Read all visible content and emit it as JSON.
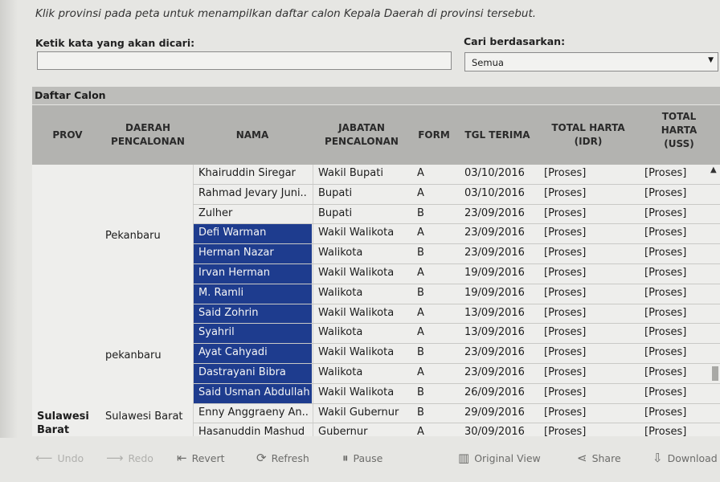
{
  "instruction": "Klik provinsi pada peta untuk menampilkan daftar calon Kepala Daerah di provinsi tersebut.",
  "search": {
    "label": "Ketik kata yang akan dicari:",
    "value": ""
  },
  "filter": {
    "label": "Cari berdasarkan:",
    "value": "Semua"
  },
  "table": {
    "title": "Daftar Calon",
    "headers": {
      "prov": "PROV",
      "daerah_1": "DAERAH",
      "daerah_2": "PENCALONAN",
      "nama": "NAMA",
      "jabatan_1": "JABATAN",
      "jabatan_2": "PENCALONAN",
      "form": "FORM",
      "tgl": "TGL TERIMA",
      "harta_idr_1": "TOTAL HARTA",
      "harta_idr_2": "(IDR)",
      "harta_uss_1": "TOTAL",
      "harta_uss_2": "HARTA",
      "harta_uss_3": "(USS)"
    },
    "groups": [
      {
        "prov": "",
        "daerah": "Pekanbaru"
      },
      {
        "prov": "",
        "daerah": "pekanbaru"
      },
      {
        "prov_1": "Sulawesi",
        "prov_2": "Barat",
        "daerah": "Sulawesi Barat"
      }
    ],
    "rows": [
      {
        "nama": "Khairuddin Siregar",
        "jabatan": "Wakil Bupati",
        "form": "A",
        "tgl": "03/10/2016",
        "idr": "[Proses]",
        "uss": "[Proses]",
        "selected": false
      },
      {
        "nama": "Rahmad Jevary Juni..",
        "jabatan": "Bupati",
        "form": "A",
        "tgl": "03/10/2016",
        "idr": "[Proses]",
        "uss": "[Proses]",
        "selected": false
      },
      {
        "nama": "Zulher",
        "jabatan": "Bupati",
        "form": "B",
        "tgl": "23/09/2016",
        "idr": "[Proses]",
        "uss": "[Proses]",
        "selected": false
      },
      {
        "nama": "Defi Warman",
        "jabatan": "Wakil Walikota",
        "form": "A",
        "tgl": "23/09/2016",
        "idr": "[Proses]",
        "uss": "[Proses]",
        "selected": true
      },
      {
        "nama": "Herman Nazar",
        "jabatan": "Walikota",
        "form": "B",
        "tgl": "23/09/2016",
        "idr": "[Proses]",
        "uss": "[Proses]",
        "selected": true
      },
      {
        "nama": "Irvan Herman",
        "jabatan": "Wakil Walikota",
        "form": "A",
        "tgl": "19/09/2016",
        "idr": "[Proses]",
        "uss": "[Proses]",
        "selected": true
      },
      {
        "nama": "M. Ramli",
        "jabatan": "Walikota",
        "form": "B",
        "tgl": "19/09/2016",
        "idr": "[Proses]",
        "uss": "[Proses]",
        "selected": true
      },
      {
        "nama": "Said Zohrin",
        "jabatan": "Wakil Walikota",
        "form": "A",
        "tgl": "13/09/2016",
        "idr": "[Proses]",
        "uss": "[Proses]",
        "selected": true
      },
      {
        "nama": "Syahril",
        "jabatan": "Walikota",
        "form": "A",
        "tgl": "13/09/2016",
        "idr": "[Proses]",
        "uss": "[Proses]",
        "selected": true
      },
      {
        "nama": "Ayat Cahyadi",
        "jabatan": "Wakil Walikota",
        "form": "B",
        "tgl": "23/09/2016",
        "idr": "[Proses]",
        "uss": "[Proses]",
        "selected": true
      },
      {
        "nama": "Dastrayani Bibra",
        "jabatan": "Walikota",
        "form": "A",
        "tgl": "23/09/2016",
        "idr": "[Proses]",
        "uss": "[Proses]",
        "selected": true
      },
      {
        "nama": "Said Usman Abdullah",
        "jabatan": "Wakil Walikota",
        "form": "B",
        "tgl": "26/09/2016",
        "idr": "[Proses]",
        "uss": "[Proses]",
        "selected": true
      },
      {
        "nama": "Enny Anggraeny An..",
        "jabatan": "Wakil Gubernur",
        "form": "B",
        "tgl": "29/09/2016",
        "idr": "[Proses]",
        "uss": "[Proses]",
        "selected": false
      },
      {
        "nama": "Hasanuddin Mashud",
        "jabatan": "Gubernur",
        "form": "A",
        "tgl": "30/09/2016",
        "idr": "[Proses]",
        "uss": "[Proses]",
        "selected": false
      }
    ]
  },
  "toolbar": {
    "undo": "Undo",
    "redo": "Redo",
    "revert": "Revert",
    "refresh": "Refresh",
    "pause": "Pause",
    "original_view": "Original View",
    "share": "Share",
    "download": "Download"
  },
  "colors": {
    "selection": "#1e3c8e",
    "header_band": "#b3b3b0",
    "background": "#e6e6e3"
  }
}
